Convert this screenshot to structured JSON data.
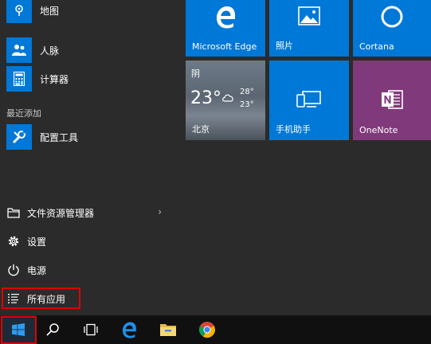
{
  "apps": [
    {
      "label": "地图",
      "icon": "map-icon"
    },
    {
      "label": "人脉",
      "icon": "people-icon"
    },
    {
      "label": "计算器",
      "icon": "calculator-icon"
    }
  ],
  "recent_section": "最近添加",
  "recent_apps": [
    {
      "label": "配置工具",
      "icon": "tools-icon"
    }
  ],
  "system": {
    "explorer": "文件资源管理器",
    "settings": "设置",
    "power": "电源",
    "all_apps": "所有应用"
  },
  "tiles": {
    "edge": "Microsoft Edge",
    "photos": "照片",
    "cortana": "Cortana",
    "phone": "手机助手",
    "onenote": "OneNote"
  },
  "weather": {
    "condition": "阴",
    "temp": "23°",
    "high": "28°",
    "low": "23°",
    "city": "北京"
  },
  "colors": {
    "accent": "#0078d7",
    "onenote": "#80397b",
    "highlight": "#e00000",
    "taskbar": "#101010",
    "menu_bg": "#2b2b2b"
  },
  "taskbar": [
    "start-icon",
    "search-icon",
    "task-view-icon",
    "edge-icon",
    "file-explorer-icon",
    "chrome-icon"
  ]
}
